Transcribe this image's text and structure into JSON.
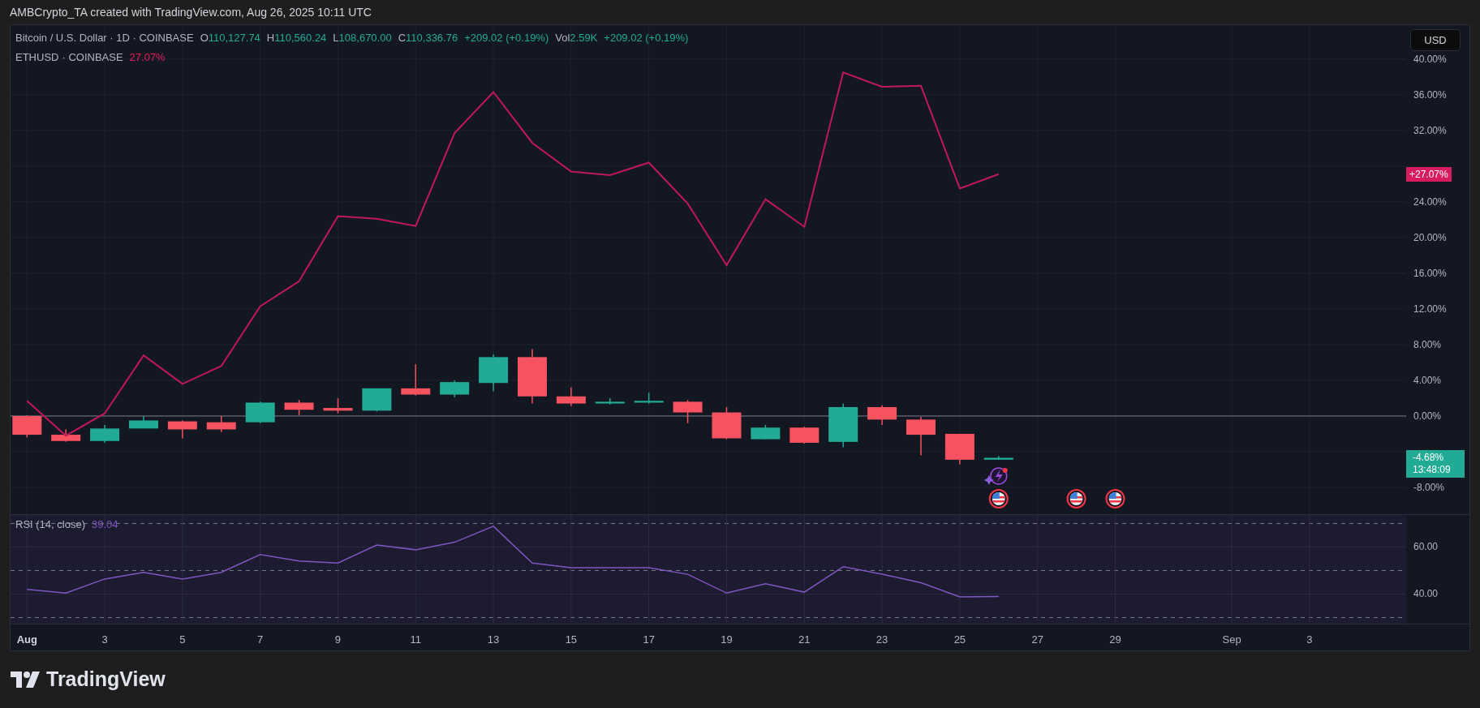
{
  "header": {
    "text": "AMBCrypto_TA created with TradingView.com, Aug 26, 2025 10:11 UTC"
  },
  "legend": {
    "symbol": "Bitcoin / U.S. Dollar · 1D · COINBASE",
    "ohlc": [
      {
        "label": "O",
        "value": "110,127.74"
      },
      {
        "label": "H",
        "value": "110,560.24"
      },
      {
        "label": "L",
        "value": "108,670.00"
      },
      {
        "label": "C",
        "value": "110,336.76"
      }
    ],
    "change": "+209.02 (+0.19%)",
    "volume": {
      "label": "Vol",
      "value": "2.59K",
      "change": "+209.02 (+0.19%)"
    },
    "compare": {
      "exchange": "· COINBASE",
      "value": "27.07%",
      "color": "#e91e63"
    }
  },
  "price_scale": {
    "currency_button": "USD",
    "tags": [
      {
        "text": "+27.07%",
        "color": "#d81b60"
      },
      {
        "text": "-4.68%",
        "timer": "13:48:09",
        "color": "#22ab94"
      }
    ]
  },
  "main_chart": {
    "chart_data": {
      "type": "line",
      "x": [
        "2025-08-01",
        "2025-08-02",
        "2025-08-03",
        "2025-08-04",
        "2025-08-05",
        "2025-08-06",
        "2025-08-07",
        "2025-08-08",
        "2025-08-09",
        "2025-08-10",
        "2025-08-11",
        "2025-08-12",
        "2025-08-13",
        "2025-08-14",
        "2025-08-15",
        "2025-08-16",
        "2025-08-17",
        "2025-08-18",
        "2025-08-19",
        "2025-08-20",
        "2025-08-21",
        "2025-08-22",
        "2025-08-23",
        "2025-08-24",
        "2025-08-25",
        "2025-08-26"
      ],
      "xlim": [
        "2025-07-31T13:50:00Z",
        "2025-09-07T03:44:00Z"
      ],
      "series": [
        {
          "name": "ETHUSD",
          "color": "#c2185b",
          "values": [
            1.7,
            -2.2,
            0.3,
            6.8,
            3.6,
            5.6,
            12.3,
            15.1,
            22.4,
            22.1,
            21.3,
            31.7,
            36.3,
            30.6,
            27.4,
            27.0,
            28.4,
            23.8,
            16.9,
            24.3,
            21.2,
            38.5,
            36.9,
            37.0,
            25.5,
            27.1
          ]
        }
      ],
      "ylim": [
        -11,
        43.8
      ],
      "yticks": [
        {
          "value": 40,
          "label": "40.00%"
        },
        {
          "value": 36,
          "label": "36.00%"
        },
        {
          "value": 32,
          "label": "32.00%"
        },
        {
          "value": 24,
          "label": "24.00%"
        },
        {
          "value": 20,
          "label": "20.00%"
        },
        {
          "value": 16,
          "label": "16.00%"
        },
        {
          "value": 12,
          "label": "12.00%"
        },
        {
          "value": 8,
          "label": "8.00%"
        },
        {
          "value": 4,
          "label": "4.00%"
        },
        {
          "value": 0,
          "label": "0.00%"
        },
        {
          "value": -8,
          "label": "-8.00%"
        }
      ],
      "grid": true
    }
  },
  "rsi": {
    "value": "39.04",
    "chart_data": {
      "type": "line",
      "x": [
        "2025-08-01",
        "2025-08-02",
        "2025-08-03",
        "2025-08-04",
        "2025-08-05",
        "2025-08-06",
        "2025-08-07",
        "2025-08-08",
        "2025-08-09",
        "2025-08-10",
        "2025-08-11",
        "2025-08-12",
        "2025-08-13",
        "2025-08-14",
        "2025-08-15",
        "2025-08-16",
        "2025-08-17",
        "2025-08-18",
        "2025-08-19",
        "2025-08-20",
        "2025-08-21",
        "2025-08-22",
        "2025-08-23",
        "2025-08-24",
        "2025-08-25",
        "2025-08-26"
      ],
      "xlim": [
        "2025-07-31T13:50:00Z",
        "2025-09-07T03:44:00Z"
      ],
      "xticks": [
        {
          "value": "2025-08-01",
          "label": "Aug"
        },
        {
          "value": "2025-08-03",
          "label": "3"
        },
        {
          "value": "2025-08-05",
          "label": "5"
        },
        {
          "value": "2025-08-07",
          "label": "7"
        },
        {
          "value": "2025-08-09",
          "label": "9"
        },
        {
          "value": "2025-08-11",
          "label": "11"
        },
        {
          "value": "2025-08-13",
          "label": "13"
        },
        {
          "value": "2025-08-15",
          "label": "15"
        },
        {
          "value": "2025-08-17",
          "label": "17"
        },
        {
          "value": "2025-08-19",
          "label": "19"
        },
        {
          "value": "2025-08-21",
          "label": "21"
        },
        {
          "value": "2025-08-23",
          "label": "23"
        },
        {
          "value": "2025-08-25",
          "label": "25"
        },
        {
          "value": "2025-08-27",
          "label": "27"
        },
        {
          "value": "2025-08-29",
          "label": "29"
        },
        {
          "value": "2025-09-01",
          "label": "Sep"
        },
        {
          "value": "2025-09-03",
          "label": "3"
        }
      ],
      "series": [
        {
          "name": "RSI (14, close)",
          "color": "#7e57c2",
          "values": [
            42,
            40.4,
            46.4,
            49.2,
            46.4,
            49.2,
            56.8,
            54,
            53.2,
            60.8,
            58.8,
            62,
            68.8,
            53.2,
            51.2,
            51.2,
            51.2,
            48.4,
            40.4,
            44.4,
            40.8,
            51.6,
            48.4,
            44.8,
            38.8,
            39.0
          ]
        }
      ],
      "ylim": [
        27.4,
        73.6
      ],
      "yticks": [
        {
          "value": 60,
          "label": "60.00"
        },
        {
          "value": 40,
          "label": "40.00"
        }
      ],
      "grid": true
    }
  },
  "footer": {
    "logo_text": "TradingView"
  }
}
